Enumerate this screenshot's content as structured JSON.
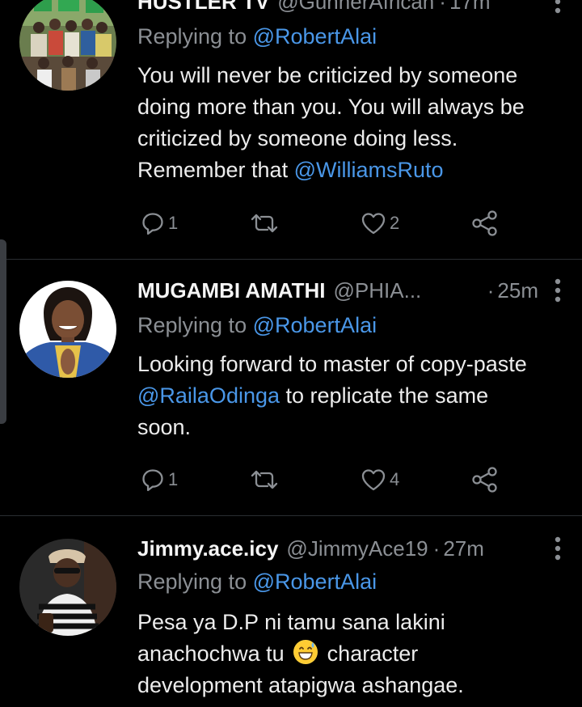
{
  "tweets": [
    {
      "display_name": "HUSTLER TV",
      "handle": "@GunnerAfrican",
      "time": "17m",
      "replying_prefix": "Replying to",
      "replying_to": "@RobertAlai",
      "body_line1": "You will never be criticized by someone",
      "body_line2": "doing more than you. You will always be",
      "body_line3": "criticized by someone doing less.",
      "body_line4_text": "Remember that",
      "body_line4_mention": "@WilliamsRuto",
      "reply_count": "1",
      "like_count": "2"
    },
    {
      "display_name": "MUGAMBI AMATHI",
      "handle": "@PHIA...",
      "time": "25m",
      "replying_prefix": "Replying to",
      "replying_to": "@RobertAlai",
      "body_line1": "Looking forward to master of copy-paste",
      "body_line2_mention": "@RailaOdinga",
      "body_line2_text": "to replicate the same",
      "body_line3": "soon.",
      "reply_count": "1",
      "like_count": "4"
    },
    {
      "display_name": "Jimmy.ace.icy",
      "handle": "@JimmyAce19",
      "time": "27m",
      "replying_prefix": "Replying to",
      "replying_to": "@RobertAlai",
      "body_line1": "Pesa ya D.P ni tamu sana lakini",
      "body_line2_before": "anachochwa tu",
      "body_line2_after": "character",
      "body_line3": "development atapigwa ashangae.",
      "emoji": "grinning-sweat-emoji"
    }
  ],
  "icons": {
    "reply": "reply-icon",
    "retweet": "retweet-icon",
    "like": "heart-icon",
    "share": "share-icon",
    "more": "more-vertical-icon"
  },
  "colors": {
    "background": "#000000",
    "text": "#e7e9ea",
    "muted": "#8b8f94",
    "link": "#4a97e8",
    "divider": "#2a2d31"
  }
}
